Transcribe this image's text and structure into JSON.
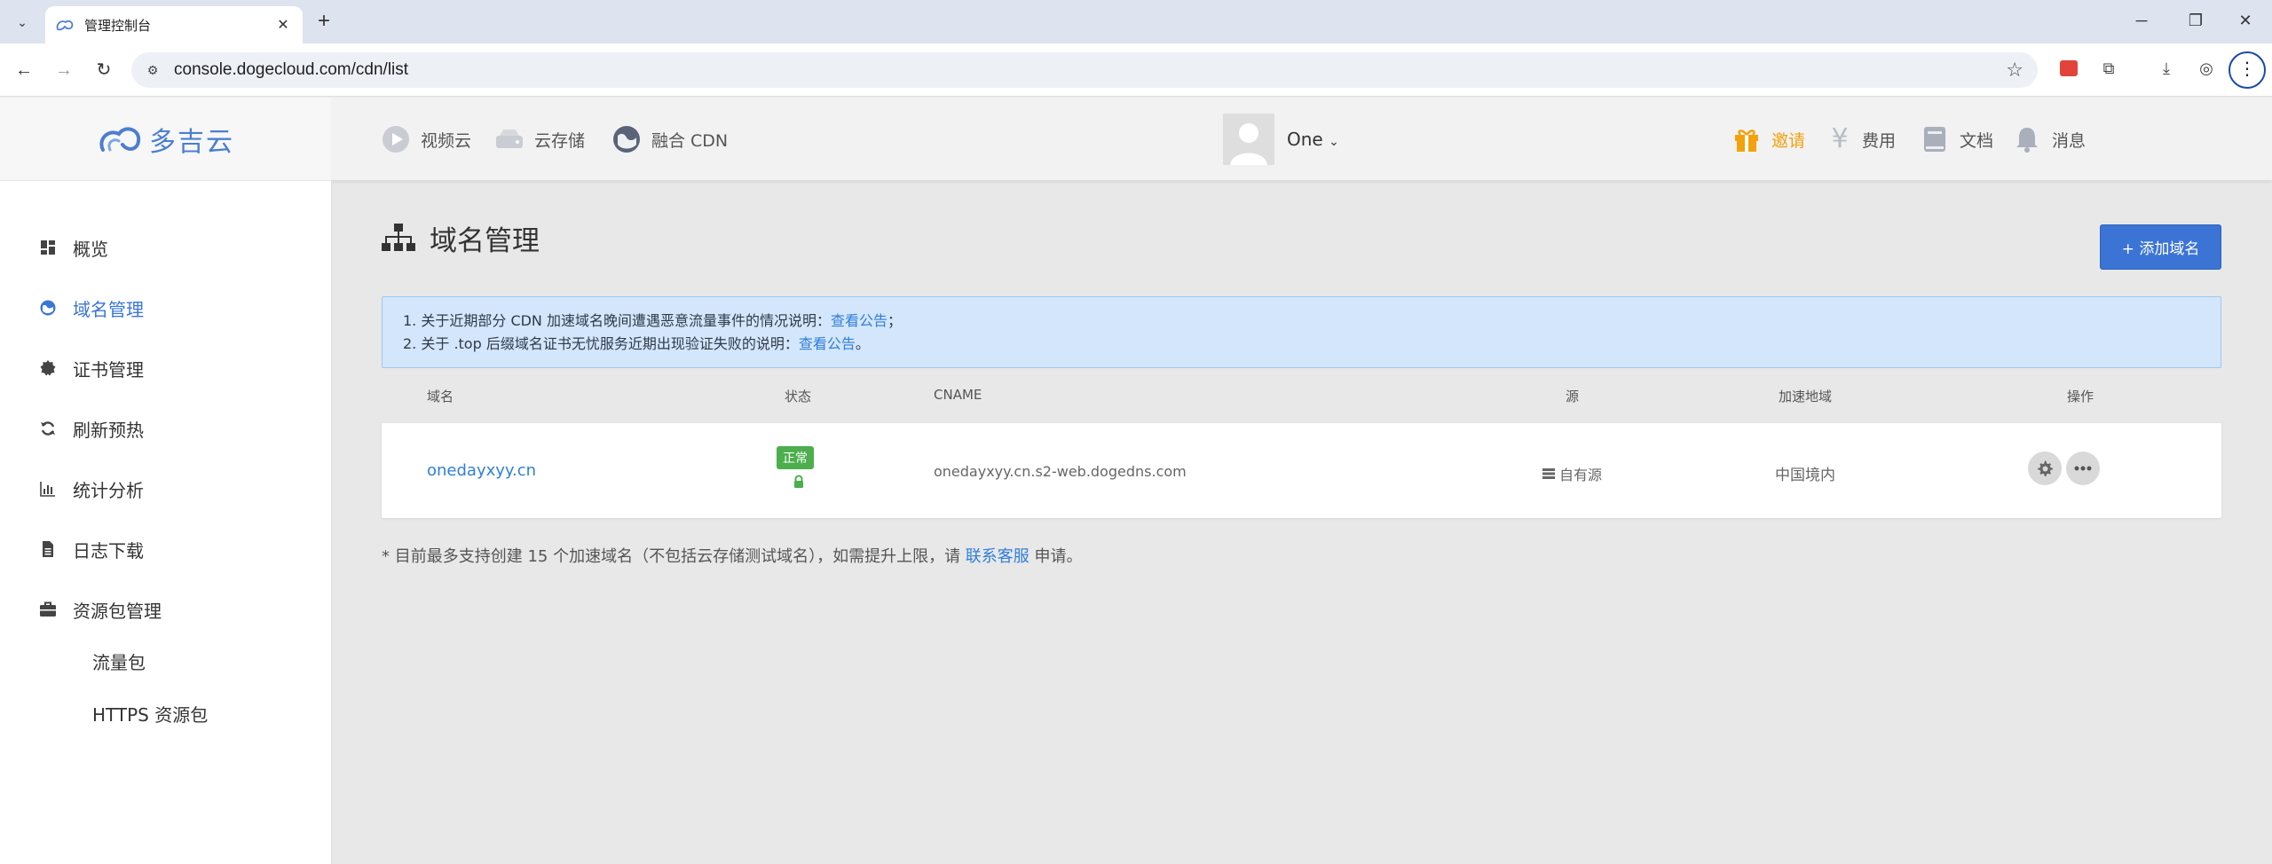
{
  "browser": {
    "tab_title": "管理控制台",
    "url": "console.dogecloud.com/cdn/list"
  },
  "app": {
    "logo_text": "多吉云",
    "nav": {
      "video": "视频云",
      "storage": "云存储",
      "cdn": "融合 CDN",
      "invite": "邀请",
      "billing": "费用",
      "docs": "文档",
      "messages": "消息"
    },
    "user_name": "One",
    "accent_color": "#3b74d4",
    "invite_color": "#f2a20c"
  },
  "sidebar": {
    "items": [
      {
        "label": "概览"
      },
      {
        "label": "域名管理"
      },
      {
        "label": "证书管理"
      },
      {
        "label": "刷新预热"
      },
      {
        "label": "统计分析"
      },
      {
        "label": "日志下载"
      },
      {
        "label": "资源包管理"
      }
    ],
    "sub_items": [
      {
        "label": "流量包"
      },
      {
        "label": "HTTPS 资源包"
      }
    ]
  },
  "main": {
    "title": "域名管理",
    "add_button": "+ 添加域名",
    "notice": {
      "line1_text": "1. 关于近期部分 CDN 加速域名晚间遭遇恶意流量事件的情况说明：",
      "line1_link": "查看公告",
      "line1_end": "；",
      "line2_text": "2. 关于 .top 后缀域名证书无忧服务近期出现验证失败的说明：",
      "line2_link": "查看公告",
      "line2_end": "。"
    },
    "table": {
      "headers": {
        "domain": "域名",
        "status": "状态",
        "cname": "CNAME",
        "source": "源",
        "region": "加速地域",
        "actions": "操作"
      },
      "rows": [
        {
          "domain": "onedayxyy.cn",
          "status": "正常",
          "cname": "onedayxyy.cn.s2-web.dogedns.com",
          "source": "自有源",
          "region": "中国境内"
        }
      ]
    },
    "footnote": {
      "prefix": "* 目前最多支持创建 15 个加速域名（不包括云存储测试域名），如需提升上限，请 ",
      "link": "联系客服",
      "suffix": " 申请。"
    }
  }
}
